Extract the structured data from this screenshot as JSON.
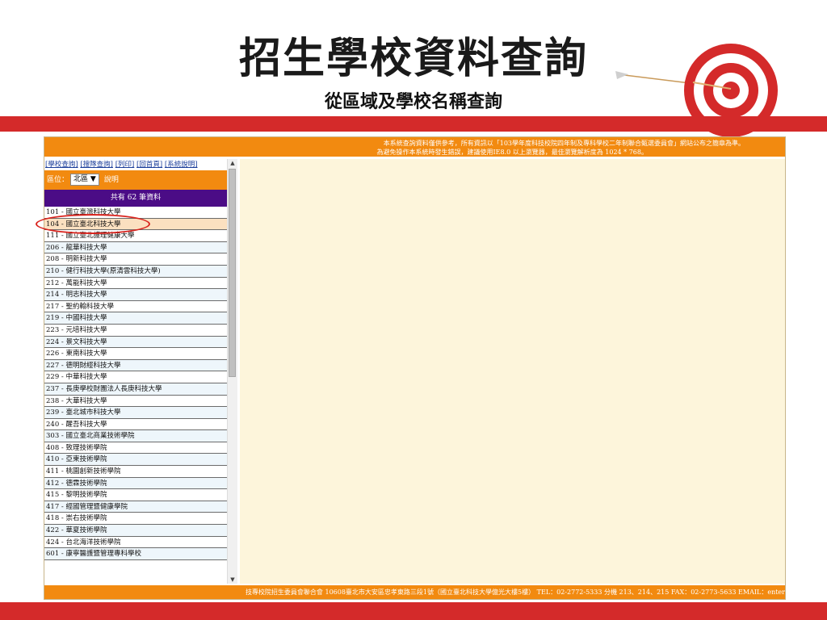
{
  "slide": {
    "title": "招生學校資料查詢",
    "subtitle": "從區域及學校名稱查詢"
  },
  "notice": {
    "line1": "本系統查詢資料僅供參考，所有資訊以「103學年度科技校院四年制及專科學校二年制聯合甄選委員會」網站公布之簡章為準。",
    "line2": "為避免操作本系統時發生錯誤，建議使用IE8.0 以上瀏覽器，最佳瀏覽解析度為 1024 * 768。"
  },
  "nav": {
    "links": [
      "[學校查詢]",
      "[搜隊查詢]",
      "[列印]",
      "[回首頁]",
      "[系統說明]"
    ]
  },
  "region": {
    "label": "區位：",
    "selected": "北區",
    "help": "說明"
  },
  "count_text": "共有 62 筆資料",
  "schools": [
    "101 - 國立臺灣科技大學",
    "104 - 國立臺北科技大學",
    "111 - 國立臺北護理健康大學",
    "206 - 龍華科技大學",
    "208 - 明新科技大學",
    "210 - 健行科技大學(原清雲科技大學)",
    "212 - 萬能科技大學",
    "214 - 明志科技大學",
    "217 - 聖約翰科技大學",
    "219 - 中國科技大學",
    "223 - 元培科技大學",
    "224 - 景文科技大學",
    "226 - 東南科技大學",
    "227 - 德明財經科技大學",
    "229 - 中華科技大學",
    "237 - 長庚學校財團法人長庚科技大學",
    "238 - 大華科技大學",
    "239 - 臺北城市科技大學",
    "240 - 醒吾科技大學",
    "303 - 國立臺北商業技術學院",
    "408 - 致理技術學院",
    "410 - 亞東技術學院",
    "411 - 桃園創新技術學院",
    "412 - 德霖技術學院",
    "415 - 黎明技術學院",
    "417 - 經國管理暨健康學院",
    "418 - 崇右技術學院",
    "422 - 華夏技術學院",
    "424 - 台北海洋技術學院",
    "601 - 康寧醫護暨管理專科學校"
  ],
  "selected_index": 1,
  "footer": "技專校院招生委員會聯合會 10608臺北市大安區忠孝東路三段1號（國立臺北科技大學億光大樓5樓） TEL：02-2772-5333 分機 213、214、215 FAX：02-2773-5633 EMAIL：enter",
  "colors": {
    "accent_red": "#d42a2a",
    "orange": "#f28a10",
    "purple": "#4b0c86",
    "content_bg": "#fdf5db",
    "highlight_circle": "#d9231d"
  }
}
